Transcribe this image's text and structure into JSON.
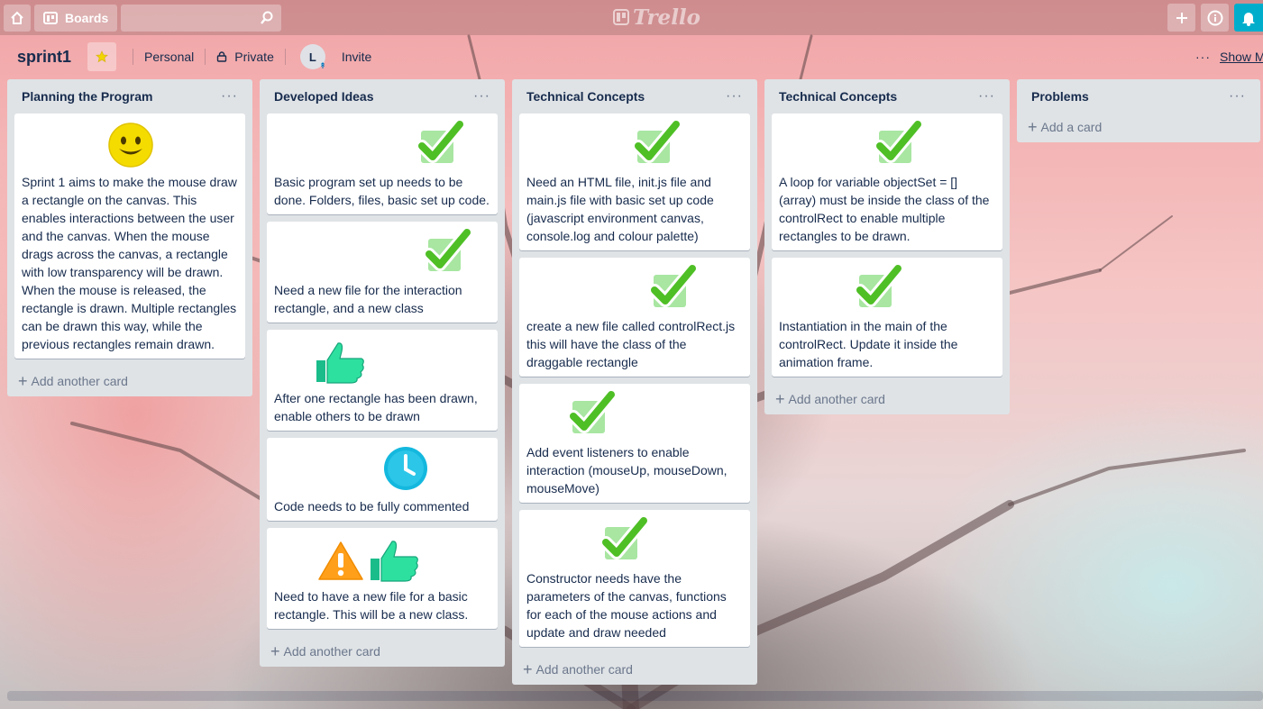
{
  "topbar": {
    "boards_label": "Boards",
    "search_value": "",
    "logo_text": "Trello"
  },
  "board": {
    "title": "sprint1",
    "team": "Personal",
    "visibility": "Private",
    "member_initial": "L",
    "invite": "Invite",
    "more": "···",
    "show_menu": "Show Menu"
  },
  "lists": [
    {
      "title": "Planning the Program",
      "add_label": "Add another card",
      "cards": [
        {
          "stickers": [
            "smiley"
          ],
          "text": "Sprint 1 aims to make the mouse draw a rectangle on the canvas. This enables interactions between the user and the canvas. When the mouse drags across the canvas, a rectangle with low transparency will be drawn. When the mouse is released, the rectangle is drawn. Multiple rectangles can be drawn this way, while the previous rectangles remain drawn."
        }
      ]
    },
    {
      "title": "Developed Ideas",
      "add_label": "Add another card",
      "cards": [
        {
          "stickers": [
            "check"
          ],
          "text": "Basic program set up needs to be done. Folders, files, basic set up code."
        },
        {
          "stickers": [
            "check"
          ],
          "text": "Need a new file for the interaction rectangle, and a new class"
        },
        {
          "stickers": [
            "thumbsup"
          ],
          "text": "After one rectangle has been drawn, enable others to be drawn"
        },
        {
          "stickers": [
            "clock"
          ],
          "text": "Code needs to be fully commented"
        },
        {
          "stickers": [
            "warning",
            "thumbsup"
          ],
          "text": "Need to have a new file for a basic rectangle. This will be a new class."
        }
      ]
    },
    {
      "title": "Technical Concepts",
      "add_label": "Add another card",
      "cards": [
        {
          "stickers": [
            "check"
          ],
          "text": "Need an HTML file, init.js file and main.js file with basic set up code (javascript environment canvas, console.log and colour palette)"
        },
        {
          "stickers": [
            "check"
          ],
          "text": "create a new file called controlRect.js this will have the class of the draggable rectangle"
        },
        {
          "stickers": [
            "check"
          ],
          "text": "Add event listeners to enable interaction (mouseUp, mouseDown, mouseMove)"
        },
        {
          "stickers": [
            "check"
          ],
          "text": "Constructor needs have the parameters of the canvas, functions for each of the mouse actions and update and draw needed"
        }
      ]
    },
    {
      "title": "Technical Concepts",
      "add_label": "Add another card",
      "cards": [
        {
          "stickers": [
            "check"
          ],
          "text": "A loop for variable objectSet = [] (array) must be inside the class of the controlRect to enable multiple rectangles to be drawn."
        },
        {
          "stickers": [
            "check"
          ],
          "text": "Instantiation in the main of the controlRect. Update it inside the animation frame."
        }
      ]
    },
    {
      "title": "Problems",
      "add_label": "Add a card",
      "cards": []
    }
  ]
}
